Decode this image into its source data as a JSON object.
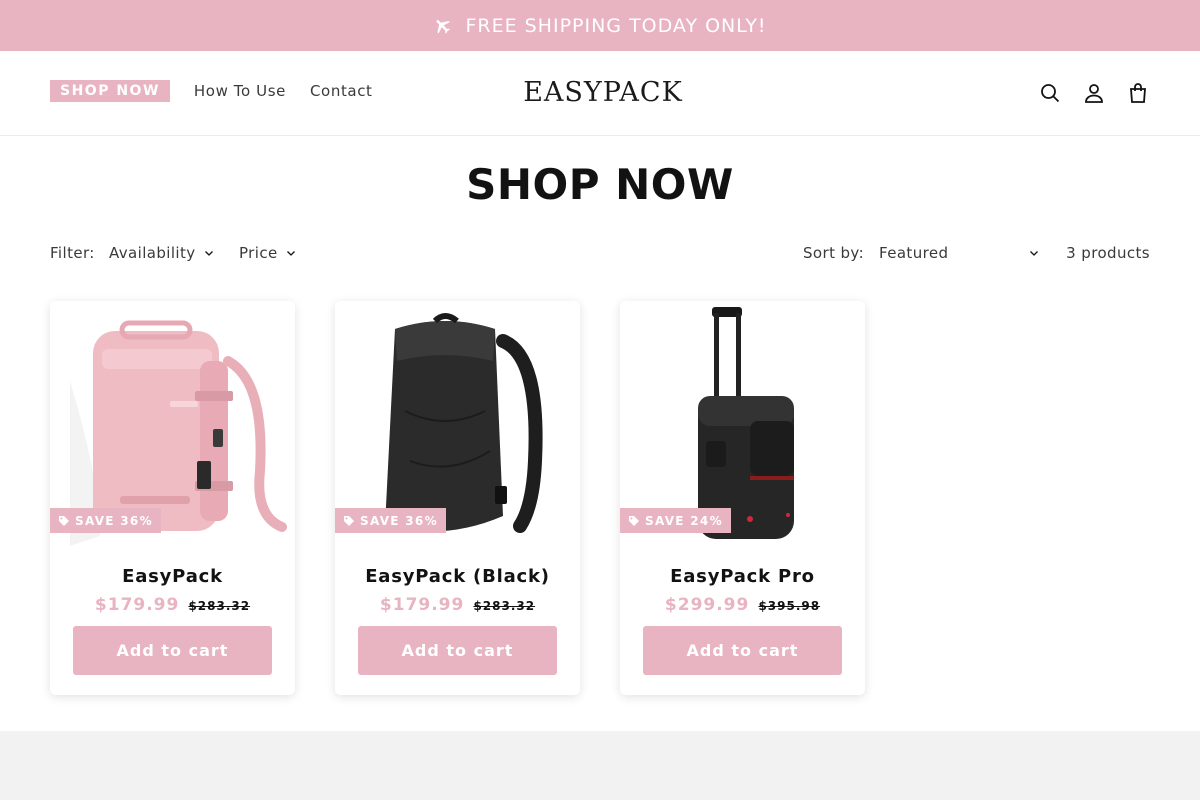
{
  "announcement": {
    "text": "FREE SHIPPING TODAY ONLY!",
    "icon": "airplane-icon"
  },
  "header": {
    "nav": [
      {
        "label": "SHOP NOW",
        "active": true
      },
      {
        "label": "How To Use"
      },
      {
        "label": "Contact"
      }
    ],
    "logo": "EASYPACK",
    "icons": [
      "search-icon",
      "account-icon",
      "cart-icon"
    ]
  },
  "page": {
    "title": "SHOP NOW"
  },
  "filters": {
    "label": "Filter:",
    "availability": "Availability",
    "price": "Price",
    "sort_label": "Sort by:",
    "sort_value": "Featured",
    "count": "3 products"
  },
  "products": [
    {
      "name": "EasyPack",
      "price": "$179.99",
      "compare_price": "$283.32",
      "badge": "SAVE 36%",
      "button": "Add to cart",
      "image": "pink-backpack"
    },
    {
      "name": "EasyPack (Black)",
      "price": "$179.99",
      "compare_price": "$283.32",
      "badge": "SAVE 36%",
      "button": "Add to cart",
      "image": "black-backpack"
    },
    {
      "name": "EasyPack Pro",
      "price": "$299.99",
      "compare_price": "$395.98",
      "badge": "SAVE 24%",
      "button": "Add to cart",
      "image": "black-rolling-backpack"
    }
  ],
  "colors": {
    "accent": "#e8b4c1",
    "text": "#121212",
    "footer": "#f2f2f2"
  }
}
